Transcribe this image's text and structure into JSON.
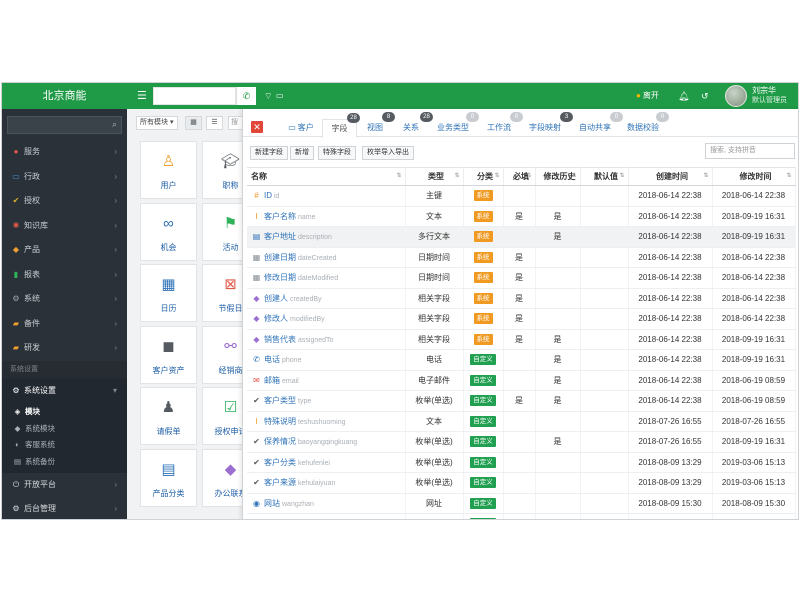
{
  "app": {
    "brand": "北京商能",
    "leave_label": "离开",
    "user_name": "刘宗华",
    "user_role": "默认管理员",
    "colors": {
      "topbar": "#1f9a46",
      "sidebar": "#2a3138",
      "system_tag": "#f09a22",
      "custom_tag": "#20a050",
      "link": "#2f73b8"
    }
  },
  "sidebar": {
    "items": [
      {
        "label": "服务",
        "icon": "circle-icon",
        "color": "#e05a4a"
      },
      {
        "label": "行政",
        "icon": "monitor-icon",
        "color": "#3a8fd8"
      },
      {
        "label": "授权",
        "icon": "check-icon",
        "color": "#e0b030"
      },
      {
        "label": "知识库",
        "icon": "lightbulb-icon",
        "color": "#e05a4a"
      },
      {
        "label": "产品",
        "icon": "cube-icon",
        "color": "#f0a030"
      },
      {
        "label": "报表",
        "icon": "chart-icon",
        "color": "#2fb35a"
      },
      {
        "label": "系统",
        "icon": "gear-icon",
        "color": "#9aa3ac"
      },
      {
        "label": "备件",
        "icon": "folder-icon",
        "color": "#f0a030"
      },
      {
        "label": "研发",
        "icon": "folder-icon",
        "color": "#f0a030"
      }
    ],
    "section_label": "系统设置",
    "system_settings": "系统设置",
    "sub_items": [
      {
        "label": "模块",
        "active": true
      },
      {
        "label": "系统模块",
        "active": false
      },
      {
        "label": "客服系统",
        "active": false
      },
      {
        "label": "系统备份",
        "active": false
      }
    ],
    "bottom_items": [
      {
        "label": "开放平台"
      },
      {
        "label": "后台管理"
      }
    ]
  },
  "modules": {
    "select_label": "所有模块 ▾",
    "mini_input": "搜",
    "tiles": [
      {
        "label": "用户",
        "icon": "user-icon",
        "color": "#f0a030"
      },
      {
        "label": "职称",
        "icon": "graduation-cap-icon",
        "color": "#555b61"
      },
      {
        "label": "机会",
        "icon": "binoculars-icon",
        "color": "#2f73b8"
      },
      {
        "label": "活动",
        "icon": "flag-icon",
        "color": "#2fb35a"
      },
      {
        "label": "日历",
        "icon": "calendar-icon",
        "color": "#2f73b8"
      },
      {
        "label": "节假日",
        "icon": "calendar-x-icon",
        "color": "#e05a4a"
      },
      {
        "label": "客户资产",
        "icon": "box-icon",
        "color": "#555b61"
      },
      {
        "label": "经销商",
        "icon": "handshake-icon",
        "color": "#9b6fd0"
      },
      {
        "label": "请假单",
        "icon": "user-remove-icon",
        "color": "#555b61"
      },
      {
        "label": "授权申请",
        "icon": "checkbox-icon",
        "color": "#2fb35a"
      },
      {
        "label": "产品分类",
        "icon": "archive-icon",
        "color": "#2f73b8"
      },
      {
        "label": "办公联系",
        "icon": "cube-icon",
        "color": "#9b6fd0"
      }
    ]
  },
  "panel": {
    "tabs": [
      {
        "label": "客户",
        "badge": "",
        "active": false
      },
      {
        "label": "字段",
        "badge": "28",
        "active": true
      },
      {
        "label": "视图",
        "badge": "8",
        "active": false
      },
      {
        "label": "关系",
        "badge": "28",
        "active": false
      },
      {
        "label": "业务类型",
        "badge": "0",
        "active": false
      },
      {
        "label": "工作流",
        "badge": "0",
        "active": false
      },
      {
        "label": "字段映射",
        "badge": "3",
        "active": false
      },
      {
        "label": "自动共享",
        "badge": "0",
        "active": false
      },
      {
        "label": "数据校验",
        "badge": "0",
        "active": false
      }
    ],
    "actions": [
      "新建字段",
      "新增",
      "特殊字段",
      "枚举导入导出"
    ],
    "search_placeholder": "搜索, 支持拼音",
    "columns": [
      "名称",
      "类型",
      "分类",
      "必填",
      "修改历史",
      "默认值",
      "创建时间",
      "修改时间"
    ],
    "rows": [
      {
        "icon": "#",
        "icon_name": "hash-icon",
        "icon_color": "#f09a22",
        "name": "ID",
        "code": "id",
        "type": "主键",
        "category": "系统",
        "required": "",
        "history": "",
        "default": "",
        "created": "2018-06-14 22:38",
        "modified": "2018-06-14 22:38",
        "highlight": false
      },
      {
        "icon": "I",
        "icon_name": "text-cursor-icon",
        "icon_color": "#f09a22",
        "name": "客户名称",
        "code": "name",
        "type": "文本",
        "category": "系统",
        "required": "是",
        "history": "是",
        "default": "",
        "created": "2018-06-14 22:38",
        "modified": "2018-09-19 16:31",
        "highlight": false
      },
      {
        "icon": "▤",
        "icon_name": "textarea-icon",
        "icon_color": "#2f73b8",
        "name": "客户地址",
        "code": "description",
        "type": "多行文本",
        "category": "系统",
        "required": "",
        "history": "是",
        "default": "",
        "created": "2018-06-14 22:38",
        "modified": "2018-09-19 16:31",
        "highlight": true
      },
      {
        "icon": "▦",
        "icon_name": "calendar-icon",
        "icon_color": "#8a9096",
        "name": "创建日期",
        "code": "dateCreated",
        "type": "日期时间",
        "category": "系统",
        "required": "是",
        "history": "",
        "default": "",
        "created": "2018-06-14 22:38",
        "modified": "2018-06-14 22:38",
        "highlight": false
      },
      {
        "icon": "▦",
        "icon_name": "calendar-icon",
        "icon_color": "#8a9096",
        "name": "修改日期",
        "code": "dateModified",
        "type": "日期时间",
        "category": "系统",
        "required": "是",
        "history": "",
        "default": "",
        "created": "2018-06-14 22:38",
        "modified": "2018-06-14 22:38",
        "highlight": false
      },
      {
        "icon": "◆",
        "icon_name": "cube-icon",
        "icon_color": "#9b6fd0",
        "name": "创建人",
        "code": "createdBy",
        "type": "相关字段",
        "category": "系统",
        "required": "是",
        "history": "",
        "default": "",
        "created": "2018-06-14 22:38",
        "modified": "2018-06-14 22:38",
        "highlight": false
      },
      {
        "icon": "◆",
        "icon_name": "cube-icon",
        "icon_color": "#9b6fd0",
        "name": "修改人",
        "code": "modifiedBy",
        "type": "相关字段",
        "category": "系统",
        "required": "是",
        "history": "",
        "default": "",
        "created": "2018-06-14 22:38",
        "modified": "2018-06-14 22:38",
        "highlight": false
      },
      {
        "icon": "◆",
        "icon_name": "cube-icon",
        "icon_color": "#9b6fd0",
        "name": "销售代表",
        "code": "assignedTo",
        "type": "相关字段",
        "category": "系统",
        "required": "是",
        "history": "是",
        "default": "",
        "created": "2018-06-14 22:38",
        "modified": "2018-09-19 16:31",
        "highlight": false
      },
      {
        "icon": "✆",
        "icon_name": "phone-icon",
        "icon_color": "#2f73b8",
        "name": "电话",
        "code": "phone",
        "type": "电话",
        "category": "自定义",
        "required": "",
        "history": "是",
        "default": "",
        "created": "2018-06-14 22:38",
        "modified": "2018-09-19 16:31",
        "highlight": false
      },
      {
        "icon": "✉",
        "icon_name": "envelope-icon",
        "icon_color": "#e05a4a",
        "name": "邮箱",
        "code": "email",
        "type": "电子邮件",
        "category": "自定义",
        "required": "",
        "history": "是",
        "default": "",
        "created": "2018-06-14 22:38",
        "modified": "2018-06-19 08:59",
        "highlight": false
      },
      {
        "icon": "✔",
        "icon_name": "check-circle-icon",
        "icon_color": "#555b61",
        "name": "客户类型",
        "code": "type",
        "type": "枚举(单选)",
        "category": "自定义",
        "required": "是",
        "history": "是",
        "default": "",
        "created": "2018-06-14 22:38",
        "modified": "2018-06-19 08:59",
        "highlight": false
      },
      {
        "icon": "I",
        "icon_name": "text-cursor-icon",
        "icon_color": "#f09a22",
        "name": "特殊说明",
        "code": "teshushuoming",
        "type": "文本",
        "category": "自定义",
        "required": "",
        "history": "",
        "default": "",
        "created": "2018-07-26 16:55",
        "modified": "2018-07-26 16:55",
        "highlight": false
      },
      {
        "icon": "✔",
        "icon_name": "check-circle-icon",
        "icon_color": "#555b61",
        "name": "保养情况",
        "code": "baoyangqingkuang",
        "type": "枚举(单选)",
        "category": "自定义",
        "required": "",
        "history": "是",
        "default": "",
        "created": "2018-07-26 16:55",
        "modified": "2018-09-19 16:31",
        "highlight": false
      },
      {
        "icon": "✔",
        "icon_name": "check-circle-icon",
        "icon_color": "#555b61",
        "name": "客户分类",
        "code": "kehufenlei",
        "type": "枚举(单选)",
        "category": "自定义",
        "required": "",
        "history": "",
        "default": "",
        "created": "2018-08-09 13:29",
        "modified": "2019-03-06 15:13",
        "highlight": false
      },
      {
        "icon": "✔",
        "icon_name": "check-circle-icon",
        "icon_color": "#555b61",
        "name": "客户来源",
        "code": "kehulaiyuan",
        "type": "枚举(单选)",
        "category": "自定义",
        "required": "",
        "history": "",
        "default": "",
        "created": "2018-08-09 13:29",
        "modified": "2019-03-06 15:13",
        "highlight": false
      },
      {
        "icon": "◉",
        "icon_name": "globe-icon",
        "icon_color": "#2f73b8",
        "name": "网站",
        "code": "wangzhan",
        "type": "网址",
        "category": "自定义",
        "required": "",
        "history": "",
        "default": "",
        "created": "2018-08-09 15:30",
        "modified": "2018-08-09 15:30",
        "highlight": false
      },
      {
        "icon": "✔",
        "icon_name": "check-circle-icon",
        "icon_color": "#555b61",
        "name": "",
        "code": "",
        "type": "",
        "category": "自定义",
        "required": "",
        "history": "",
        "default": "",
        "created": "",
        "modified": "",
        "highlight": false
      }
    ]
  }
}
